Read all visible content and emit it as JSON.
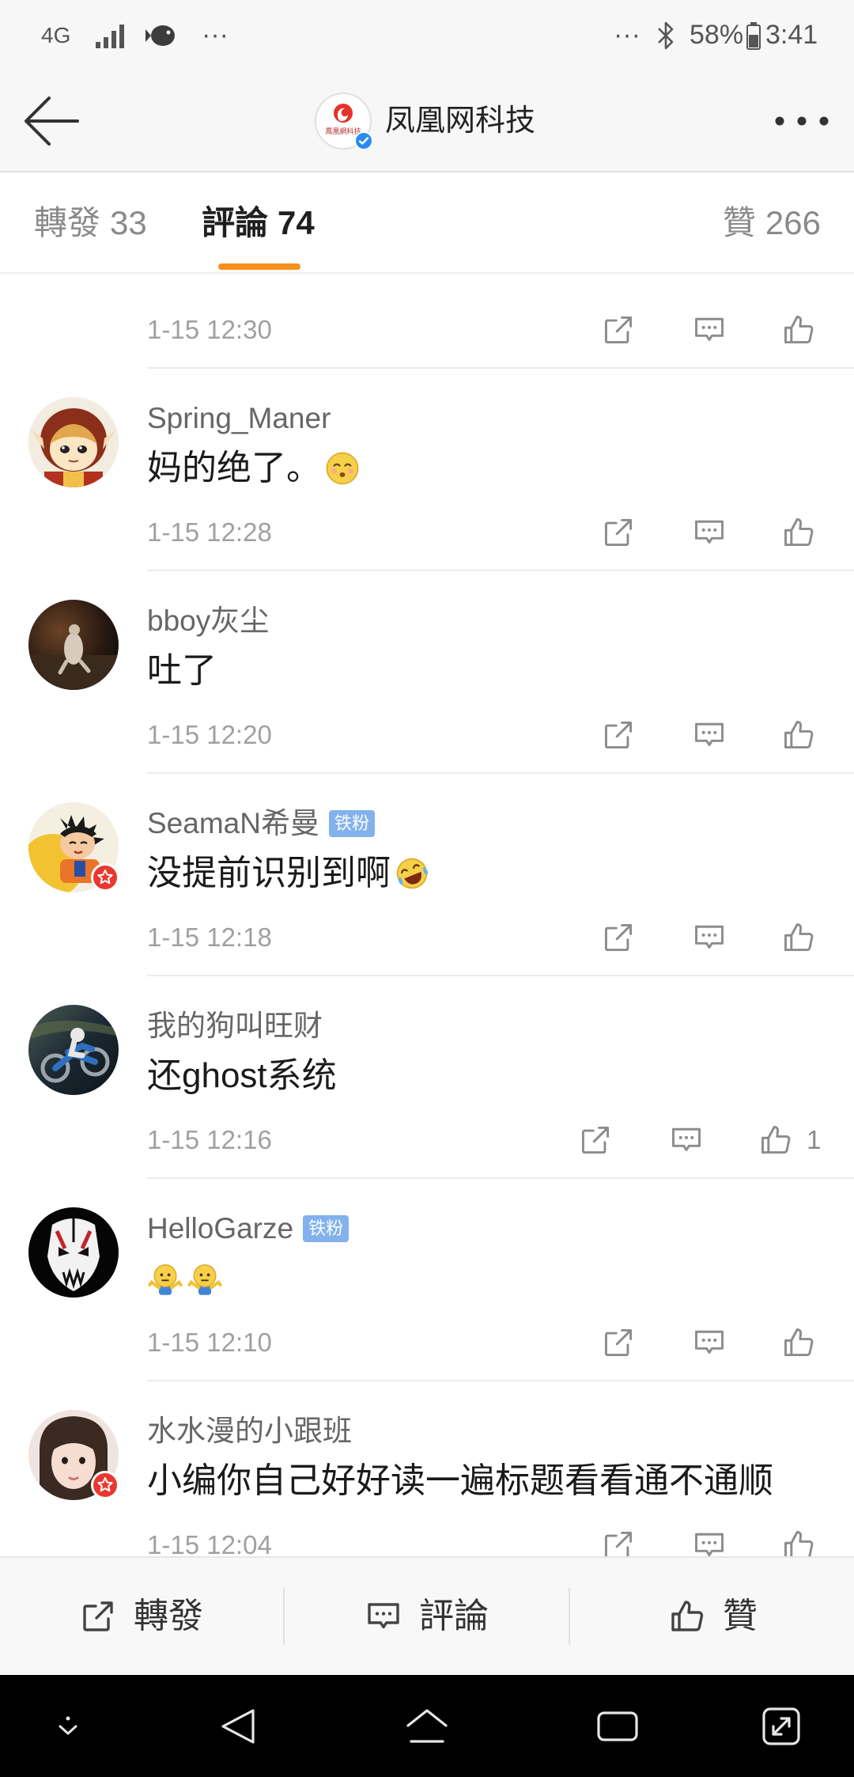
{
  "status_bar": {
    "network": "4G",
    "left_more": "···",
    "right_more": "···",
    "battery": "58%",
    "time": "3:41"
  },
  "header": {
    "title": "凤凰网科技",
    "avatar_logo_text": "鳳凰網科技"
  },
  "tabs": [
    {
      "label": "轉發",
      "count": "33"
    },
    {
      "label": "評論",
      "count": "74"
    },
    {
      "label": "贊",
      "count": "266"
    }
  ],
  "comments": [
    {
      "time": "1-15 12:30"
    },
    {
      "username": "Spring_Maner",
      "text": "妈的绝了。",
      "emoji": [
        "shy-smile-emoji"
      ],
      "time": "1-15 12:28"
    },
    {
      "username": "bboy灰尘",
      "text": "吐了",
      "time": "1-15 12:20"
    },
    {
      "username": "SeamaN希曼",
      "badge": "铁粉",
      "text": "没提前识别到啊",
      "emoji": [
        "laugh-cry-emoji"
      ],
      "time": "1-15 12:18"
    },
    {
      "username": "我的狗叫旺财",
      "text": "还ghost系统",
      "time": "1-15 12:16",
      "like_count": "1"
    },
    {
      "username": "HelloGarze",
      "badge": "铁粉",
      "emoji": [
        "shrug-emoji",
        "shrug-emoji"
      ],
      "time": "1-15 12:10"
    },
    {
      "username": "水水漫的小跟班",
      "text": "小编你自己好好读一遍标题看看通不通顺",
      "time": "1-15 12:04"
    }
  ],
  "row_actions": [
    "share-icon",
    "comment-icon",
    "like-icon"
  ],
  "bottom_bar": {
    "repost": "轉發",
    "comment": "評論",
    "like": "贊"
  },
  "colors": {
    "accent": "#f7901e",
    "fan_badge": "#82b1ee",
    "text_primary": "#1a1a1a",
    "text_secondary": "#a0a0a0",
    "nav_bar": "#000000"
  }
}
